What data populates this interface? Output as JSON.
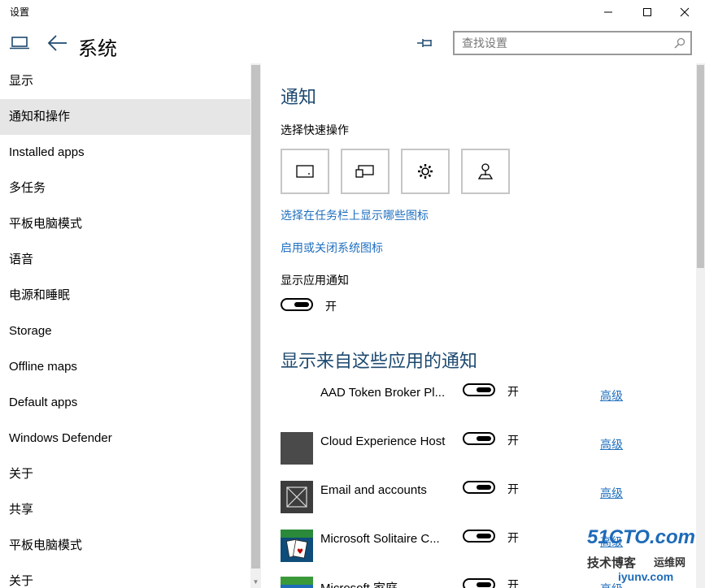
{
  "window": {
    "title": "设置"
  },
  "header": {
    "title": "系统"
  },
  "search": {
    "placeholder": "查找设置"
  },
  "sidebar": {
    "items": [
      {
        "label": "显示"
      },
      {
        "label": "通知和操作",
        "selected": true
      },
      {
        "label": "Installed apps"
      },
      {
        "label": "多任务"
      },
      {
        "label": "平板电脑模式"
      },
      {
        "label": "语音"
      },
      {
        "label": "电源和睡眠"
      },
      {
        "label": "Storage"
      },
      {
        "label": "Offline maps"
      },
      {
        "label": "Default apps"
      },
      {
        "label": "Windows Defender"
      },
      {
        "label": "关于"
      },
      {
        "label": "共享"
      },
      {
        "label": "平板电脑模式"
      },
      {
        "label": "关于"
      }
    ]
  },
  "main": {
    "heading": "通知",
    "quick_actions_label": "选择快速操作",
    "quick_actions": [
      "tablet-mode-icon",
      "project-icon",
      "settings-gear-icon",
      "location-icon"
    ],
    "link_taskbar_icons": "选择在任务栏上显示哪些图标",
    "link_system_icons": "启用或关闭系统图标",
    "show_app_notifications_label": "显示应用通知",
    "show_app_notifications_state": "开",
    "apps_heading": "显示来自这些应用的通知",
    "apps": [
      {
        "name": "AAD Token Broker Pl...",
        "state": "开",
        "advanced": "高级",
        "icon": "none"
      },
      {
        "name": "Cloud Experience Host",
        "state": "开",
        "advanced": "高级",
        "icon": "dark-square-icon"
      },
      {
        "name": "Email and accounts",
        "state": "开",
        "advanced": "高级",
        "icon": "placeholder-x-icon"
      },
      {
        "name": "Microsoft Solitaire C...",
        "state": "开",
        "advanced": "高级",
        "icon": "solitaire-cards-icon"
      },
      {
        "name": "Microsoft 家庭",
        "state": "开",
        "advanced": "高级",
        "icon": "family-app-icon"
      }
    ]
  },
  "watermark": {
    "line1": "51CTO.com",
    "line2": "技术博客",
    "line3": "运维网",
    "line4": "iyunv.com"
  },
  "colors": {
    "accent_heading": "#1e4a70",
    "link": "#1f6fbf",
    "selected_bg": "#e6e6e6"
  }
}
